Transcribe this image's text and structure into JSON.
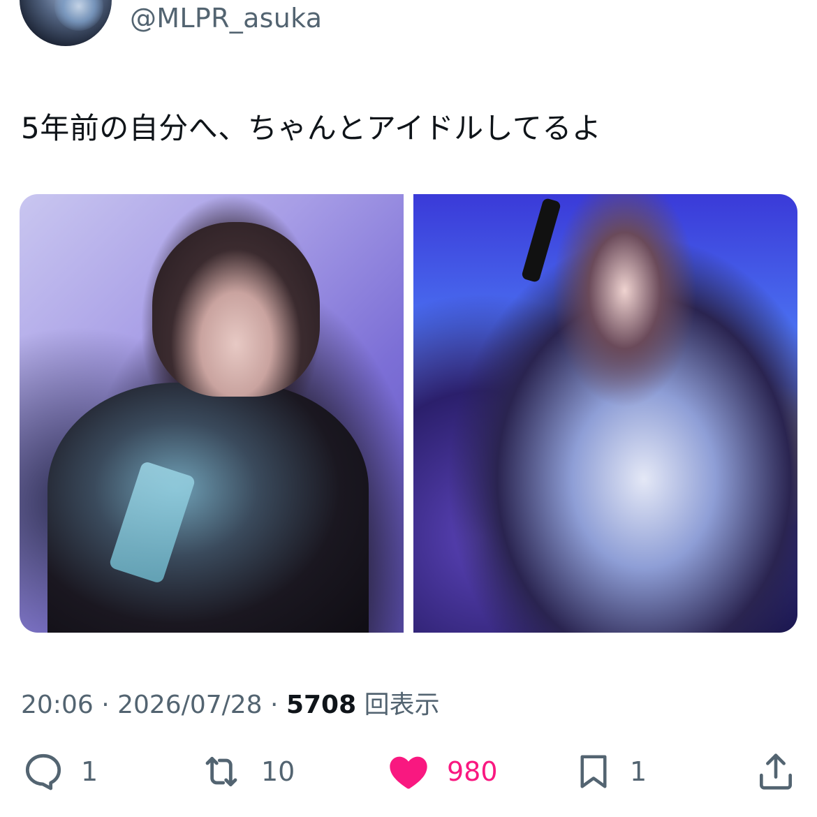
{
  "user": {
    "handle": "@MLPR_asuka"
  },
  "tweet": {
    "text": "5年前の自分へ、ちゃんとアイドルしてるよ",
    "time": "20:06",
    "separator": " · ",
    "date": "2026/07/28",
    "views_count": "5708",
    "views_label": "回表示"
  },
  "media": [
    {
      "description_icon": "photo"
    },
    {
      "description_icon": "photo"
    }
  ],
  "actions": {
    "reply_count": "1",
    "retweet_count": "10",
    "like_count": "980",
    "bookmark_count": "1"
  },
  "colors": {
    "text": "#0f1419",
    "secondary": "#536471",
    "like": "#f91880"
  }
}
